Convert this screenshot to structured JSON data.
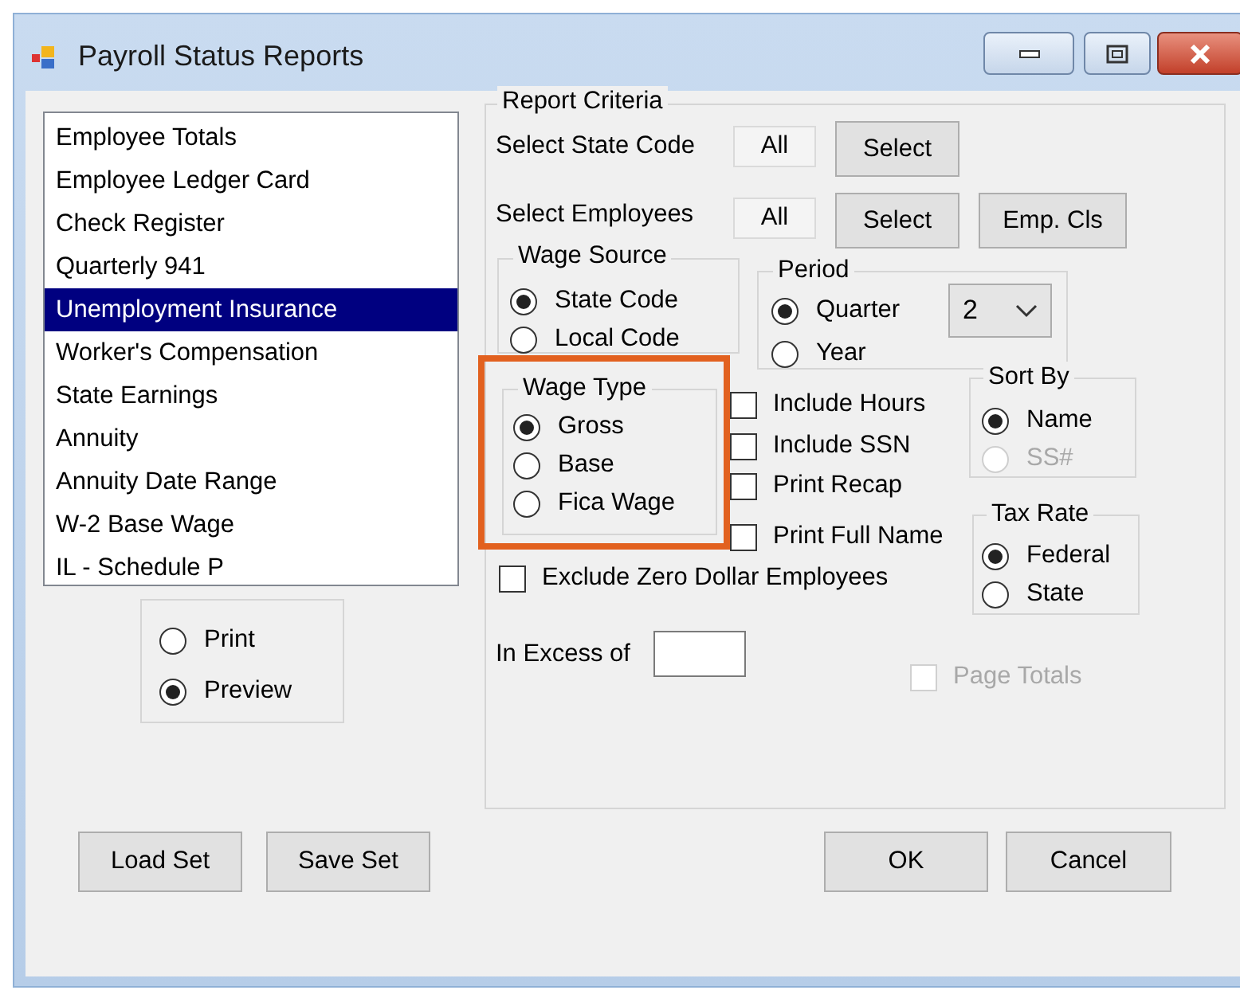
{
  "window": {
    "title": "Payroll Status Reports"
  },
  "report_list": [
    {
      "label": "Employee Totals",
      "selected": false
    },
    {
      "label": "Employee Ledger Card",
      "selected": false
    },
    {
      "label": "Check Register",
      "selected": false
    },
    {
      "label": "Quarterly 941",
      "selected": false
    },
    {
      "label": "Unemployment Insurance",
      "selected": true
    },
    {
      "label": "Worker's Compensation",
      "selected": false
    },
    {
      "label": "State Earnings",
      "selected": false
    },
    {
      "label": "Annuity",
      "selected": false
    },
    {
      "label": "Annuity Date Range",
      "selected": false
    },
    {
      "label": "W-2 Base Wage",
      "selected": false
    },
    {
      "label": "IL - Schedule P",
      "selected": false
    }
  ],
  "output": [
    {
      "label": "Print",
      "selected": false
    },
    {
      "label": "Preview",
      "selected": true
    }
  ],
  "criteria": {
    "title": "Report Criteria",
    "state_code": {
      "label": "Select State Code",
      "value": "All",
      "button": "Select"
    },
    "employees": {
      "label": "Select Employees",
      "value": "All",
      "buttons": [
        "Select",
        "Emp. Cls"
      ]
    },
    "wage_source": {
      "title": "Wage Source",
      "options": [
        {
          "label": "State Code",
          "selected": true
        },
        {
          "label": "Local Code",
          "selected": false
        }
      ]
    },
    "period": {
      "title": "Period",
      "options": [
        {
          "label": "Quarter",
          "selected": true
        },
        {
          "label": "Year",
          "selected": false
        }
      ],
      "quarter": "2"
    },
    "wage_type": {
      "title": "Wage Type",
      "highlighted": true,
      "options": [
        {
          "label": "Gross",
          "selected": true
        },
        {
          "label": "Base",
          "selected": false
        },
        {
          "label": "Fica Wage",
          "selected": false
        }
      ]
    },
    "options": [
      {
        "label": "Include Hours",
        "checked": false
      },
      {
        "label": "Include SSN",
        "checked": false
      },
      {
        "label": "Print Recap",
        "checked": false
      },
      {
        "label": "Print Full Name",
        "checked": false
      }
    ],
    "sort_by": {
      "title": "Sort By",
      "options": [
        {
          "label": "Name",
          "selected": true,
          "disabled": false
        },
        {
          "label": "SS#",
          "selected": false,
          "disabled": true
        }
      ]
    },
    "tax_rate": {
      "title": "Tax Rate",
      "options": [
        {
          "label": "Federal",
          "selected": true
        },
        {
          "label": "State",
          "selected": false
        }
      ]
    },
    "exclude_zero": {
      "label": "Exclude Zero Dollar Employees",
      "checked": false
    },
    "in_excess": {
      "label": "In Excess of"
    },
    "page_totals": {
      "label": "Page Totals",
      "checked": false,
      "disabled": true
    }
  },
  "buttons": [
    "Load Set",
    "Save Set",
    "OK",
    "Cancel"
  ]
}
